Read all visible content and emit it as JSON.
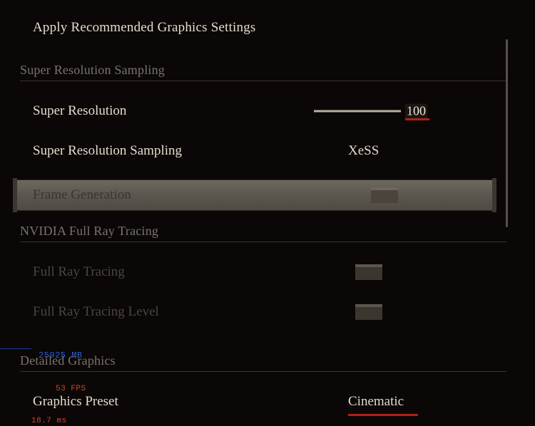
{
  "apply_label": "Apply Recommended Graphics Settings",
  "sections": {
    "srs": {
      "header": "Super Resolution Sampling",
      "super_resolution": {
        "label": "Super Resolution",
        "value": "100"
      },
      "srs_mode": {
        "label": "Super Resolution Sampling",
        "value": "XeSS"
      },
      "frame_gen": {
        "label": "Frame Generation"
      }
    },
    "rt": {
      "header": "NVIDIA Full Ray Tracing",
      "full_rt": {
        "label": "Full Ray Tracing"
      },
      "full_rt_level": {
        "label": "Full Ray Tracing Level"
      }
    },
    "detailed": {
      "header": "Detailed Graphics",
      "preset": {
        "label": "Graphics Preset",
        "value": "Cinematic"
      }
    }
  },
  "debug": {
    "mem": "25925 MB",
    "fps": "53 FPS",
    "ms": "18.7 ms"
  }
}
